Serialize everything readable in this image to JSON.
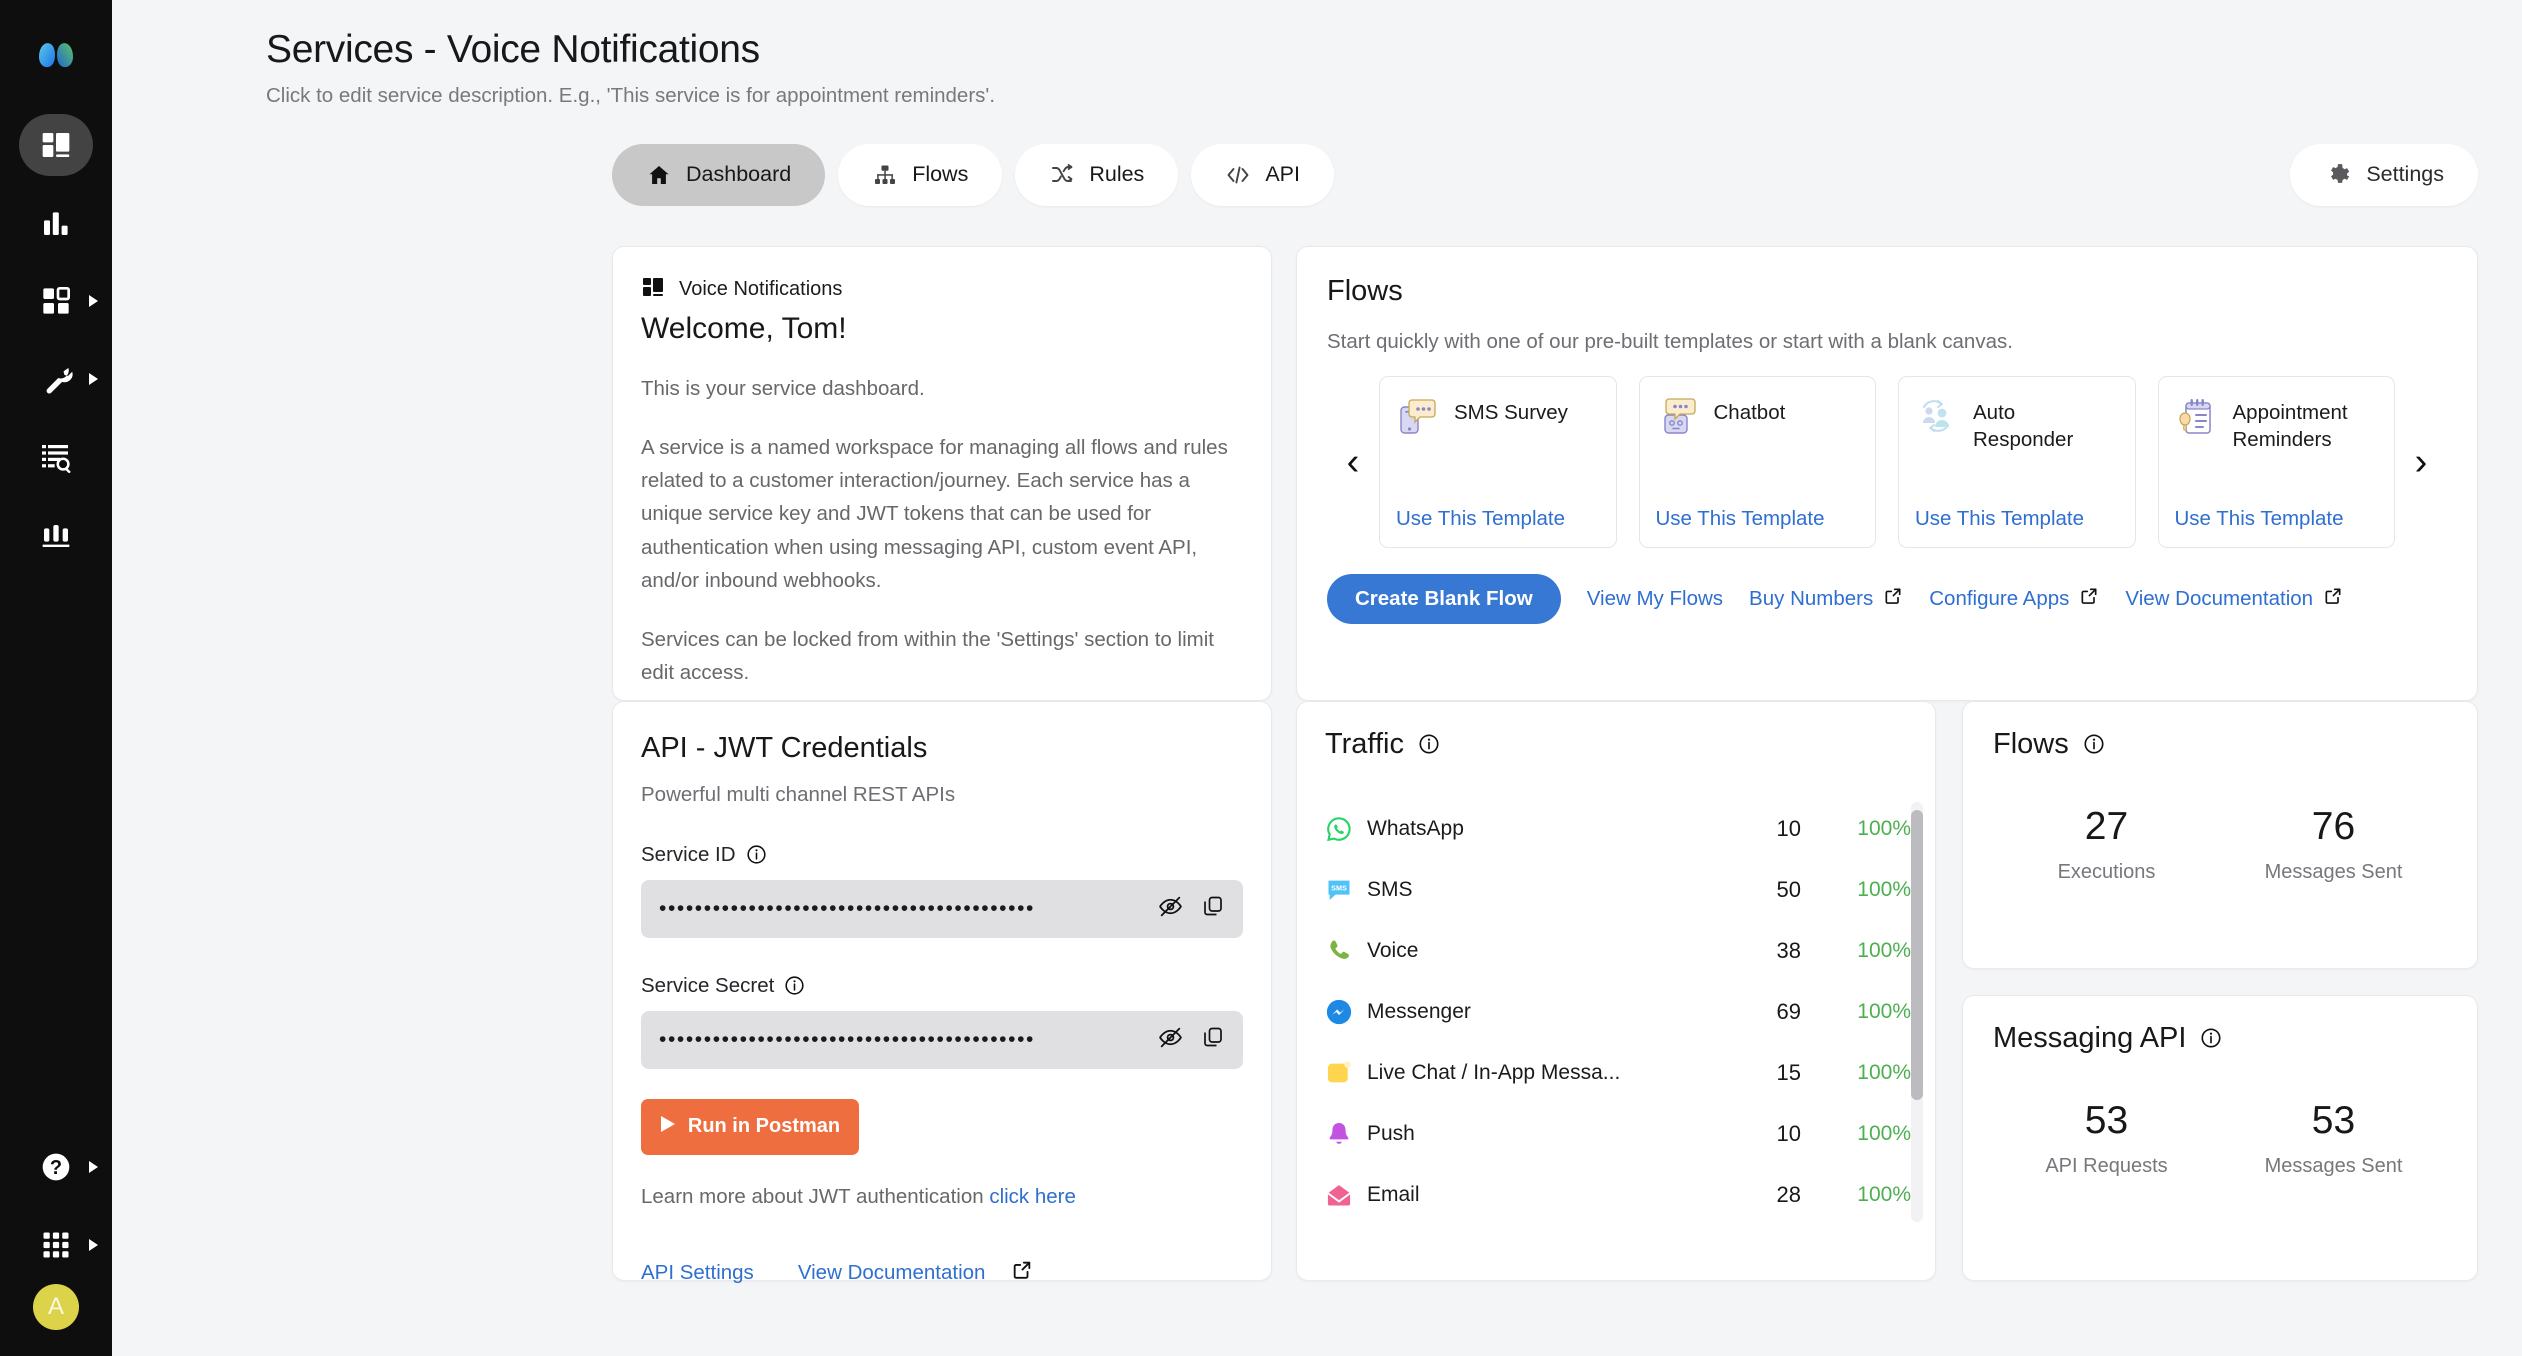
{
  "sidebar": {
    "logo_name": "webex-logo",
    "items": [
      {
        "name": "dashboard-grid-icon",
        "icon": "layout",
        "active": true,
        "has_caret": false
      },
      {
        "name": "analytics-bar-icon",
        "icon": "bars",
        "active": false,
        "has_caret": false
      },
      {
        "name": "apps-grid-icon",
        "icon": "squares",
        "active": false,
        "has_caret": true
      },
      {
        "name": "tools-wrench-icon",
        "icon": "wrench",
        "active": false,
        "has_caret": true
      },
      {
        "name": "logs-search-icon",
        "icon": "list-search",
        "active": false,
        "has_caret": false
      },
      {
        "name": "reports-chart-icon",
        "icon": "chart",
        "active": false,
        "has_caret": false
      }
    ],
    "bottom_items": [
      {
        "name": "help-icon",
        "icon": "question",
        "has_caret": true
      },
      {
        "name": "app-switcher-icon",
        "icon": "dots-grid",
        "has_caret": true
      }
    ],
    "avatar_initial": "A"
  },
  "header": {
    "title": "Services - Voice Notifications",
    "subtitle": "Click to edit service description. E.g., 'This service is for appointment reminders'."
  },
  "tabs": [
    {
      "label": "Dashboard",
      "icon": "home-icon",
      "active": true
    },
    {
      "label": "Flows",
      "icon": "flows-hierarchy-icon",
      "active": false
    },
    {
      "label": "Rules",
      "icon": "shuffle-icon",
      "active": false
    },
    {
      "label": "API",
      "icon": "code-brackets-icon",
      "active": false
    }
  ],
  "settings": {
    "label": "Settings",
    "icon": "gear-icon"
  },
  "welcome": {
    "service_label": "Voice Notifications",
    "service_icon": "dashboard-grid-icon",
    "title": "Welcome, Tom!",
    "paragraph1": "This is your service dashboard.",
    "paragraph2": "A service is a named workspace for managing all flows and rules related to a customer interaction/journey. Each service has a unique service key and JWT tokens that can be used for authentication when using messaging API, custom event API, and/or inbound webhooks.",
    "paragraph3": "Services can be locked from within the 'Settings' section to limit edit access."
  },
  "flows_panel": {
    "title": "Flows",
    "subtitle": "Start quickly with one of our pre-built templates or start with a blank canvas.",
    "prev_arrow": "‹",
    "next_arrow": "›",
    "templates": [
      {
        "name": "SMS Survey",
        "cta": "Use This Template",
        "icon": "sms-survey-icon"
      },
      {
        "name": "Chatbot",
        "cta": "Use This Template",
        "icon": "chatbot-icon"
      },
      {
        "name": "Auto Responder",
        "cta": "Use This Template",
        "icon": "auto-responder-icon"
      },
      {
        "name": "Appointment Reminders",
        "cta": "Use This Template",
        "icon": "appointment-reminders-icon"
      }
    ],
    "actions": {
      "create_blank": "Create Blank Flow",
      "view_my_flows": "View My Flows",
      "buy_numbers": "Buy Numbers",
      "configure_apps": "Configure Apps",
      "view_documentation": "View Documentation"
    }
  },
  "api_card": {
    "title": "API - JWT Credentials",
    "subtitle": "Powerful multi channel REST APIs",
    "service_id_label": "Service ID",
    "service_id_value": "••••••••••••••••••••••••••••••••••••••••••",
    "service_secret_label": "Service Secret",
    "service_secret_value": "••••••••••••••••••••••••••••••••••••••••••",
    "postman_button": "Run in Postman",
    "learn_text": "Learn more about JWT authentication ",
    "learn_link": "click here",
    "footer_links": [
      "API Settings",
      "View Documentation"
    ]
  },
  "traffic": {
    "title": "Traffic",
    "rows": [
      {
        "channel": "WhatsApp",
        "count": "10",
        "percent": "100%",
        "icon": "whatsapp-icon",
        "color": "#25D366"
      },
      {
        "channel": "SMS",
        "count": "50",
        "percent": "100%",
        "icon": "sms-icon",
        "color": "#4FC3F7"
      },
      {
        "channel": "Voice",
        "count": "38",
        "percent": "100%",
        "icon": "voice-phone-icon",
        "color": "#7CB342"
      },
      {
        "channel": "Messenger",
        "count": "69",
        "percent": "100%",
        "icon": "messenger-icon",
        "color": "#1E88E5"
      },
      {
        "channel": "Live Chat / In-App Messa...",
        "count": "15",
        "percent": "100%",
        "icon": "live-chat-icon",
        "color": "#FFD54F"
      },
      {
        "channel": "Push",
        "count": "10",
        "percent": "100%",
        "icon": "push-bell-icon",
        "color": "#C252E0"
      },
      {
        "channel": "Email",
        "count": "28",
        "percent": "100%",
        "icon": "email-icon",
        "color": "#F06292"
      }
    ]
  },
  "flows_stats": {
    "title": "Flows",
    "items": [
      {
        "value": "27",
        "label": "Executions"
      },
      {
        "value": "76",
        "label": "Messages Sent"
      }
    ]
  },
  "messaging_api_stats": {
    "title": "Messaging API",
    "items": [
      {
        "value": "53",
        "label": "API Requests"
      },
      {
        "value": "53",
        "label": "Messages Sent"
      }
    ]
  },
  "colors": {
    "accent_blue": "#3678d4",
    "link_blue": "#2f6fd0",
    "postman_orange": "#ee6e3f",
    "success_green": "#4caf50",
    "sidebar_bg": "#0e0e0e",
    "page_bg": "#f4f5f7"
  }
}
